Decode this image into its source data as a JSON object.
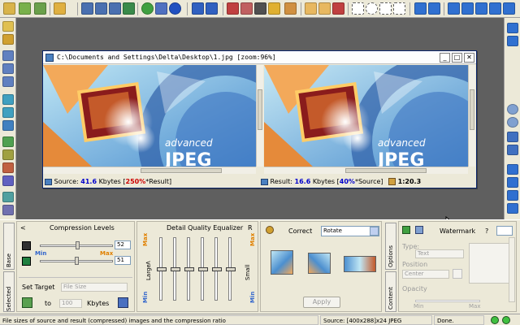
{
  "window": {
    "title": "C:\\Documents and Settings\\Delta\\Desktop\\1.jpg  [zoom:96%]",
    "minimize_glyph": "_",
    "maximize_glyph": "□",
    "close_glyph": "✕"
  },
  "image_status": {
    "source_label": "Source:",
    "source_size": "41.6",
    "source_unit": "Kbytes",
    "source_pct": "250%",
    "source_ref": "*Result",
    "result_label": "Result:",
    "result_size": "16.6",
    "result_unit": "Kbytes",
    "result_pct": "40%",
    "result_ref": "*Source",
    "ratio": "1:20.3"
  },
  "compression": {
    "title": "Compression Levels",
    "collapse_glyph": "<",
    "min_label": "Min",
    "max_label": "Max",
    "slider1_value": "52",
    "slider2_value": "51",
    "slider1_level": 0.52,
    "slider2_level": 0.51,
    "set_target_label": "Set Target",
    "target_mode": "File Size",
    "to_label": "to",
    "target_value": "100",
    "target_unit": "Kbytes"
  },
  "equalizer": {
    "title": "Detail Quality Equalizer",
    "reset_label": "R",
    "max_label": "Max",
    "min_label": "Min",
    "large_label": "Large",
    "small_label": "Small",
    "arrow_glyph": "<",
    "levels": [
      0.5,
      0.5,
      0.5,
      0.5,
      0.5,
      0.5
    ]
  },
  "correct": {
    "title": "Correct",
    "mode": "Rotate",
    "apply_label": "Apply"
  },
  "side_tabs": {
    "base": "Base",
    "selected": "Selected",
    "options": "Options",
    "content": "Content"
  },
  "watermark": {
    "title": "Watermark",
    "help": "?",
    "type_label": "Type:",
    "type_value": "Text",
    "position_label": "Position",
    "position_value": "Center",
    "opacity_label": "Opacity",
    "min_label": "Min",
    "max_label": "Max"
  },
  "statusbar": {
    "message": "File sizes of source and result (compressed) images and the compression ratio",
    "source_info": "Source: [400x288]x24 JPEG",
    "state": "Done."
  },
  "colors": {
    "workspace": "#5f5f5f",
    "accent_red": "#cc0000",
    "accent_blue": "#0000cc",
    "slider_label_blue": "#3366cc",
    "slider_label_orange": "#e08000"
  }
}
